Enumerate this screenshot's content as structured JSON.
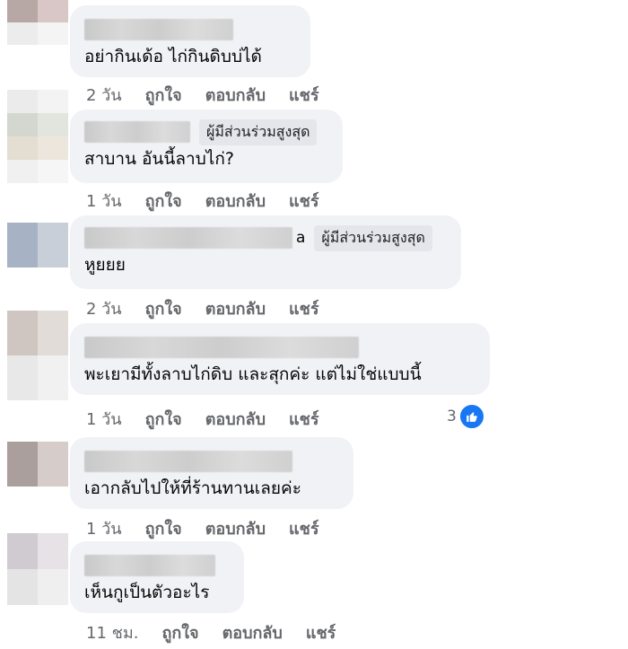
{
  "actions": {
    "like": "ถูกใจ",
    "reply": "ตอบกลับ",
    "share": "แชร์"
  },
  "badge_label": "ผู้มีส่วนร่วมสูงสุด",
  "comments": [
    {
      "text": "อย่ากินเด้อ ไก่กินดิบบ่ได้",
      "time": "2 วัน"
    },
    {
      "text": "สาบาน อันนี้ลาบไก่?",
      "time": "1 วัน"
    },
    {
      "text": "หูยยย",
      "time": "2 วัน",
      "name_fragment": "a"
    },
    {
      "text": "พะเยามีทั้งลาบไก่ดิบ และสุกค่ะ แต่ไม่ใช่แบบนี้",
      "time": "1 วัน",
      "reaction_count": "3"
    },
    {
      "text": "เอากลับไปให้ที่ร้านทานเลยค่ะ",
      "time": "1 วัน"
    },
    {
      "text": "เห็นกูเป็นตัวอะไร",
      "time": "11 ชม."
    }
  ],
  "colors": {
    "bubble": "#f0f2f5",
    "meta": "#65676b",
    "like_blue": "#1877f2"
  },
  "icons": [
    "like-icon"
  ]
}
